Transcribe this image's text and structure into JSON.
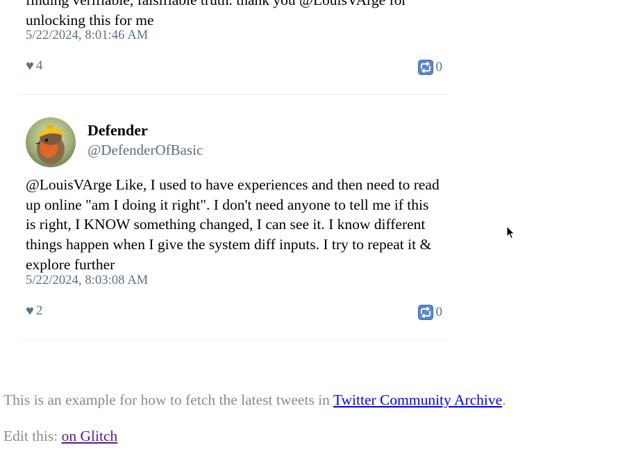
{
  "tweets": [
    {
      "text": "finding verifiable, falsifiable truth. thank you @LouisVArge for unlocking this for me",
      "timestamp": "5/22/2024, 8:01:46 AM",
      "likes": "4",
      "retweets": "0"
    },
    {
      "display_name": "Defender",
      "handle": "@DefenderOfBasic",
      "text": "@LouisVArge Like, I used to have experiences and then need to read up online \"am I doing it right\". I don't need anyone to tell me if this is right, I KNOW something changed, I can see it. I know different things happen when I give the system diff inputs. I try to repeat it & explore further",
      "timestamp": "5/22/2024, 8:03:08 AM",
      "likes": "2",
      "retweets": "0"
    }
  ],
  "footer": {
    "line1_prefix": "This is an example for how to fetch the latest tweets in ",
    "line1_link": "Twitter Community Archive",
    "line1_suffix": ".",
    "line2_prefix": "Edit this: ",
    "line2_link": "on Glitch"
  },
  "icons": {
    "like": "heart-icon",
    "retweet": "retweet-icon",
    "cursor": "mouse-pointer-icon"
  },
  "colors": {
    "meta_text": "#5b7083",
    "retweet_icon": "#5a87c8",
    "link": "#0000ee",
    "visited_link": "#551a8b",
    "footer_text": "#8a8a8a"
  }
}
